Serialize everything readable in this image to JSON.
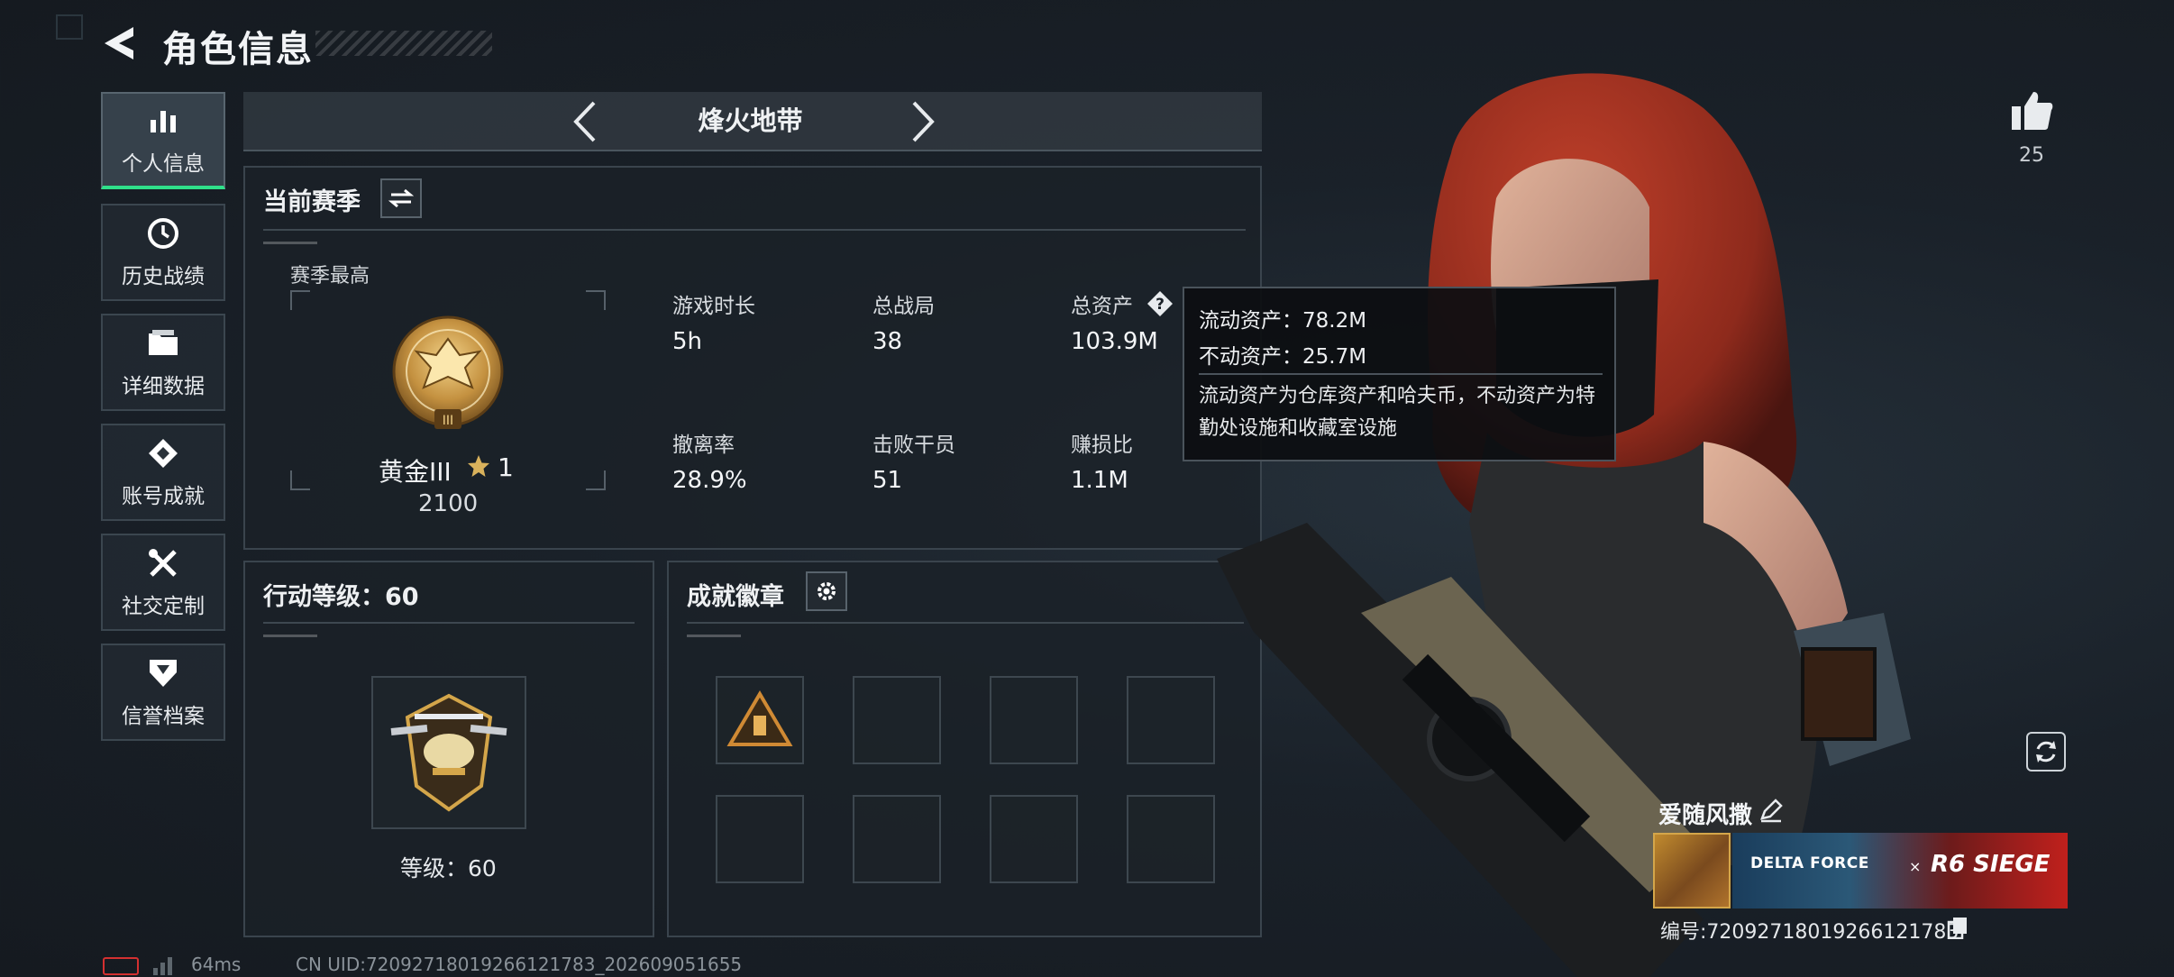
{
  "header": {
    "title": "角色信息"
  },
  "sidebar": {
    "items": [
      {
        "label": "个人信息",
        "icon": "bar-chart-icon",
        "active": true
      },
      {
        "label": "历史战绩",
        "icon": "history-clock-icon",
        "active": false
      },
      {
        "label": "详细数据",
        "icon": "folder-icon",
        "active": false
      },
      {
        "label": "账号成就",
        "icon": "achievement-diamond-icon",
        "active": false
      },
      {
        "label": "社交定制",
        "icon": "tools-icon",
        "active": false
      },
      {
        "label": "信誉档案",
        "icon": "shield-chevron-icon",
        "active": false
      }
    ]
  },
  "mode": {
    "name": "烽火地带"
  },
  "season": {
    "title": "当前赛季",
    "best_label": "赛季最高",
    "rank_name": "黄金III",
    "rank_stars": "1",
    "rank_score": "2100",
    "stats": [
      {
        "label": "游戏时长",
        "value": "5h"
      },
      {
        "label": "总战局",
        "value": "38"
      },
      {
        "label": "总资产",
        "value": "103.9M"
      },
      {
        "label": "撤离率",
        "value": "28.9%"
      },
      {
        "label": "击败干员",
        "value": "51"
      },
      {
        "label": "赚损比",
        "value": "1.1M"
      }
    ]
  },
  "tooltip": {
    "liquid": "流动资产：78.2M",
    "fixed": "不动资产：25.7M",
    "description": "流动资产为仓库资产和哈夫币，不动资产为特勤处设施和收藏室设施"
  },
  "action_level": {
    "title": "行动等级：60",
    "level_label": "等级：60"
  },
  "achievements": {
    "title": "成就徽章"
  },
  "profile": {
    "likes": "25",
    "player_name": "爱随风撒",
    "banner_brand": "DELTA FORCE",
    "banner_x": "×",
    "banner_collab": "R6 SIEGE",
    "player_id": "编号:7209271801926612178​3"
  },
  "status": {
    "ping": "64ms",
    "uid": "CN UID:7209271801926612178​3_202609051655"
  },
  "colors": {
    "accent": "#2fe08a",
    "gold": "#c9a45a",
    "panel": "#1b2128"
  }
}
